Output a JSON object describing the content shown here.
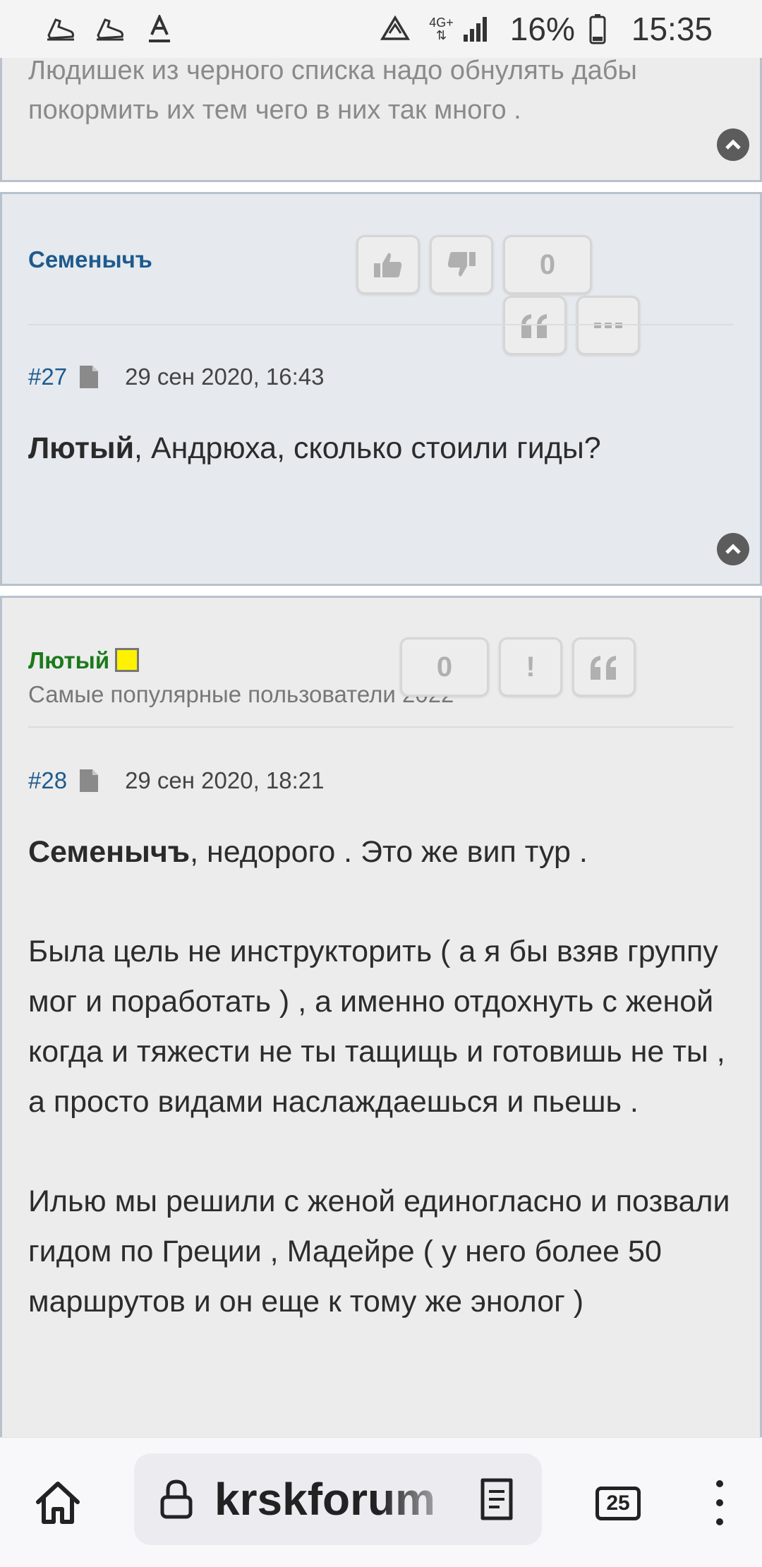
{
  "status_bar": {
    "network": "4G+",
    "battery": "16%",
    "time": "15:35"
  },
  "prev_post": {
    "text": "Людишек из черного списка надо обнулять дабы покормить их тем чего в них так много ."
  },
  "post27": {
    "author": "Семенычъ",
    "votes": "0",
    "number": "#27",
    "date": "29 сен 2020, 16:43",
    "mention": "Лютый",
    "text": ", Андрюха, сколько стоили гиды?"
  },
  "post28": {
    "author": "Лютый",
    "user_title": "Самые популярные пользователи 2022",
    "votes": "0",
    "report_label": "!",
    "number": "#28",
    "date": "29 сен 2020, 18:21",
    "mention": "Семенычъ",
    "line1": ", недорого . Это же вип тур .",
    "para2": "Была цель не инструкторить ( а я бы взяв группу мог и поработать ) , а именно отдохнуть с женой когда и тяжести не ты тащищь и готовишь не ты , а просто видами наслаждаешься и пьешь .",
    "para3": "Илью мы решили с женой единогласно и позвали гидом по Греции , Мадейре ( у него более 50 маршрутов и он еще к тому же энолог )"
  },
  "bottom_bar": {
    "url": "krskforum",
    "tab_count": "25"
  },
  "colors": {
    "link_blue": "#1e5a8e",
    "author_green": "#1a7a1a",
    "rank_yellow": "#fff200"
  },
  "icons": [
    "shoe-icon",
    "shoe-icon",
    "font-underline-icon",
    "data-saver-icon",
    "signal-icon",
    "battery-icon",
    "thumbs-up-icon",
    "thumbs-down-icon",
    "quote-icon",
    "more-icon",
    "scroll-up-icon",
    "document-icon",
    "home-icon",
    "lock-icon",
    "reader-mode-icon",
    "tabs-icon",
    "menu-dots-icon"
  ]
}
